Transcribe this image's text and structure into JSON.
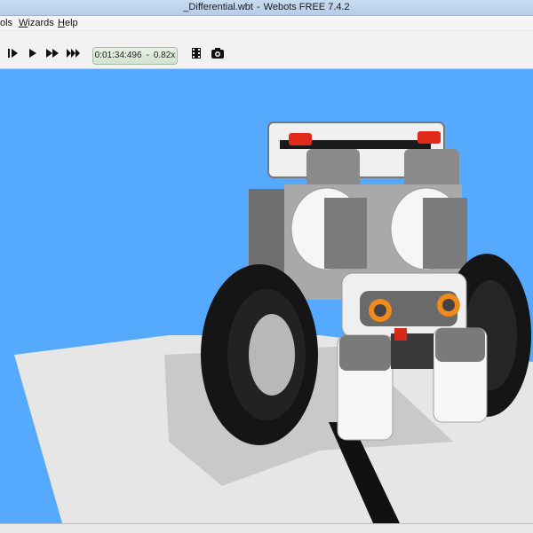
{
  "window": {
    "title_file": "_Differential.wbt",
    "title_separator": "-",
    "title_app": "Webots FREE 7.4.2"
  },
  "menubar": {
    "items": [
      {
        "label": "ols",
        "underline_index": -1
      },
      {
        "label": "Wizards",
        "underline_index": 0
      },
      {
        "label": "Help",
        "underline_index": 0
      }
    ]
  },
  "toolbar": {
    "step_icon": "step-icon",
    "run_icon": "play-icon",
    "fast_icon": "fast-forward-icon",
    "fastest_icon": "fastest-icon",
    "time": "0:01:34:496",
    "time_separator": "-",
    "speed": "0.82x",
    "record_icon": "film-icon",
    "screenshot_icon": "camera-icon"
  },
  "scene": {
    "background_color": "#55aaff",
    "floor_color": "#e6e6e6",
    "line_color": "#111111",
    "robot": "LEGO Mindstorms differential-wheel robot"
  }
}
